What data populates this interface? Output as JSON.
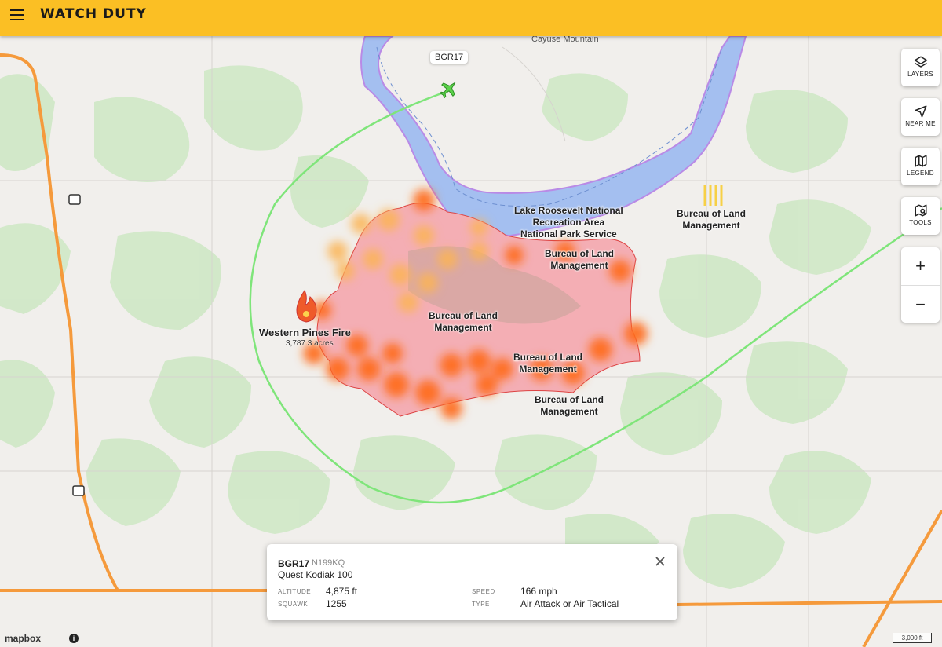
{
  "header": {
    "title": "WATCH DUTY"
  },
  "map": {
    "labels": {
      "cayuse": "Cayuse Mountain",
      "recreation_area": [
        "Lake Roosevelt National",
        "Recreation Area",
        "National Park Service"
      ],
      "blm_1": [
        "Bureau of Land",
        "Management"
      ],
      "blm_2": [
        "Bureau of Land",
        "Management"
      ],
      "blm_3": [
        "Bureau of Land",
        "Management"
      ],
      "blm_4": [
        "Bureau of Land",
        "Management"
      ],
      "blm_5": [
        "Bureau of Land",
        "Management"
      ]
    },
    "fire": {
      "name": "Western Pines Fire",
      "acres": "3,787.3 acres"
    },
    "aircraft_tag": "BGR17",
    "colors": {
      "header": "#fbbf24",
      "water": "#a4bff0",
      "perimeter": "#f4aeb4",
      "heat": "#ff6a1a",
      "track": "#7fe57a",
      "highway": "#f59a3c"
    }
  },
  "controls": {
    "layers": "LAYERS",
    "near_me": "NEAR ME",
    "legend": "LEGEND",
    "tools": "TOOLS",
    "zoom_in": "+",
    "zoom_out": "−"
  },
  "aircraft_card": {
    "callsign": "BGR17",
    "registration": "N199KQ",
    "model": "Quest Kodiak 100",
    "altitude_label": "ALTITUDE",
    "altitude": "4,875 ft",
    "squawk_label": "SQUAWK",
    "squawk": "1255",
    "speed_label": "SPEED",
    "speed": "166 mph",
    "type_label": "TYPE",
    "type": "Air Attack or Air Tactical"
  },
  "footer": {
    "attribution": "mapbox",
    "scale": "3,000 ft"
  }
}
